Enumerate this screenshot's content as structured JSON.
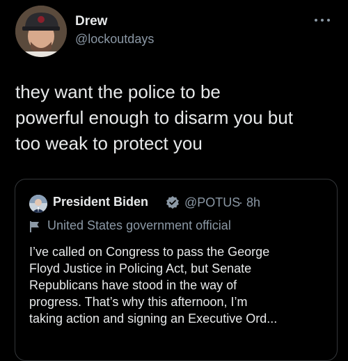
{
  "tweet": {
    "author": {
      "display_name": "Drew",
      "handle": "@lockoutdays",
      "avatar_icon": "avatar-photo"
    },
    "more_icon": "ellipsis-icon",
    "text_lines": [
      "they want the police to be",
      "powerful enough to disarm you but",
      "too weak to protect you"
    ]
  },
  "quoted_tweet": {
    "author": {
      "display_name": "President Biden",
      "handle": "@POTUS",
      "verified_icon": "verified-badge-icon",
      "avatar_icon": "avatar-photo"
    },
    "separator": "·",
    "time": "8h",
    "label_icon": "flag-icon",
    "label": "United States government official",
    "text_lines": [
      "I’ve called on Congress to pass the George",
      "Floyd Justice in Policing Act, but Senate",
      "Republicans have stood in the way of",
      "progress. That’s why this afternoon, I’m",
      "taking action and signing an Executive Ord..."
    ]
  },
  "colors": {
    "background": "#000000",
    "primary_text": "#e7e9ea",
    "secondary_text": "#8b98a5",
    "border": "#333639",
    "verified_badge": "#8b98a5"
  }
}
